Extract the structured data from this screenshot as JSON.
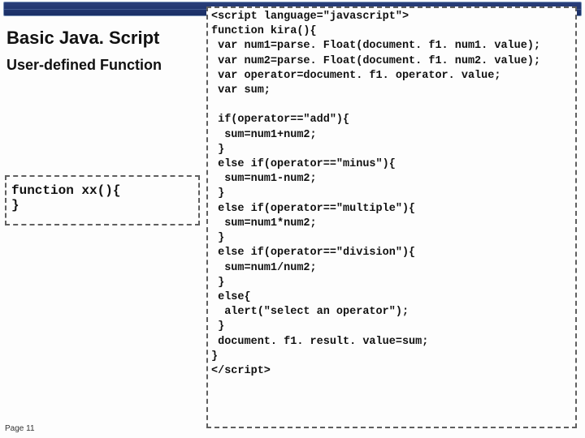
{
  "header": {
    "title": "Basic Java. Script",
    "subtitle": "User-defined Function"
  },
  "placeholder": "function xx(){\n}",
  "code_top": "<script language=\"javascript\">\nfunction kira(){\n var num1=parse. Float(document. f1. num1. value);\n var num2=parse. Float(document. f1. num2. value);\n var operator=document. f1. operator. value;\n var sum;",
  "code_bottom": " if(operator==\"add\"){\n  sum=num1+num2;\n }\n else if(operator==\"minus\"){\n  sum=num1-num2;\n }\n else if(operator==\"multiple\"){\n  sum=num1*num2;\n }\n else if(operator==\"division\"){\n  sum=num1/num2;\n }\n else{\n  alert(\"select an operator\");\n }\n document. f1. result. value=sum;\n}\n</script>",
  "footer": {
    "page": "Page 11"
  }
}
